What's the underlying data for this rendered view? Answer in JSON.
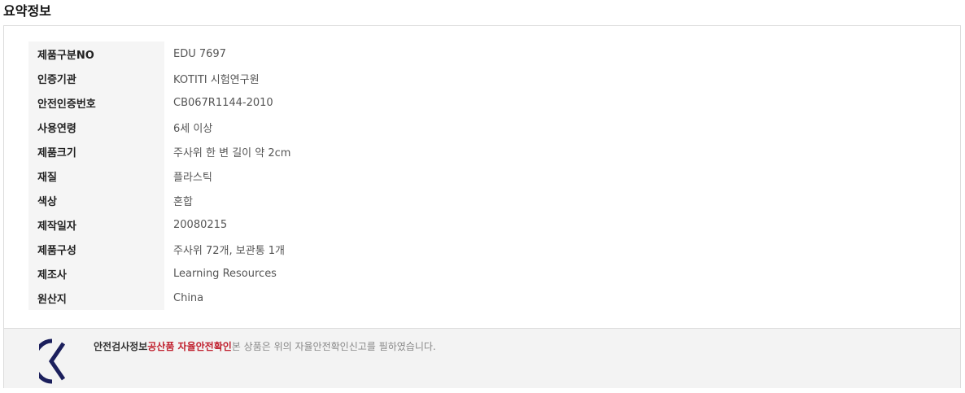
{
  "section_title": "요약정보",
  "spec_rows": [
    {
      "label": "제품구분NO",
      "value": "EDU 7697"
    },
    {
      "label": "인증기관",
      "value": "KOTITI 시험연구원"
    },
    {
      "label": "안전인증번호",
      "value": "CB067R1144-2010"
    },
    {
      "label": "사용연령",
      "value": "6세 이상"
    },
    {
      "label": "제품크기",
      "value": "주사위 한 변 길이 약 2cm"
    },
    {
      "label": "재질",
      "value": "플라스틱"
    },
    {
      "label": "색상",
      "value": "혼합"
    },
    {
      "label": "제작일자",
      "value": "20080215"
    },
    {
      "label": "제품구성",
      "value": "주사위 72개, 보관통 1개"
    },
    {
      "label": "제조사",
      "value": "Learning Resources"
    },
    {
      "label": "원산지",
      "value": "China"
    }
  ],
  "safety_notice": {
    "label": "안전검사정보",
    "link_text": "공산품 자율안전확인",
    "description": "본 상품은 위의 자율안전확인신고를 필하였습니다.",
    "icon": "kc-certification-mark-icon",
    "link_color": "#c0202e",
    "mark_color": "#1b1f5c"
  }
}
